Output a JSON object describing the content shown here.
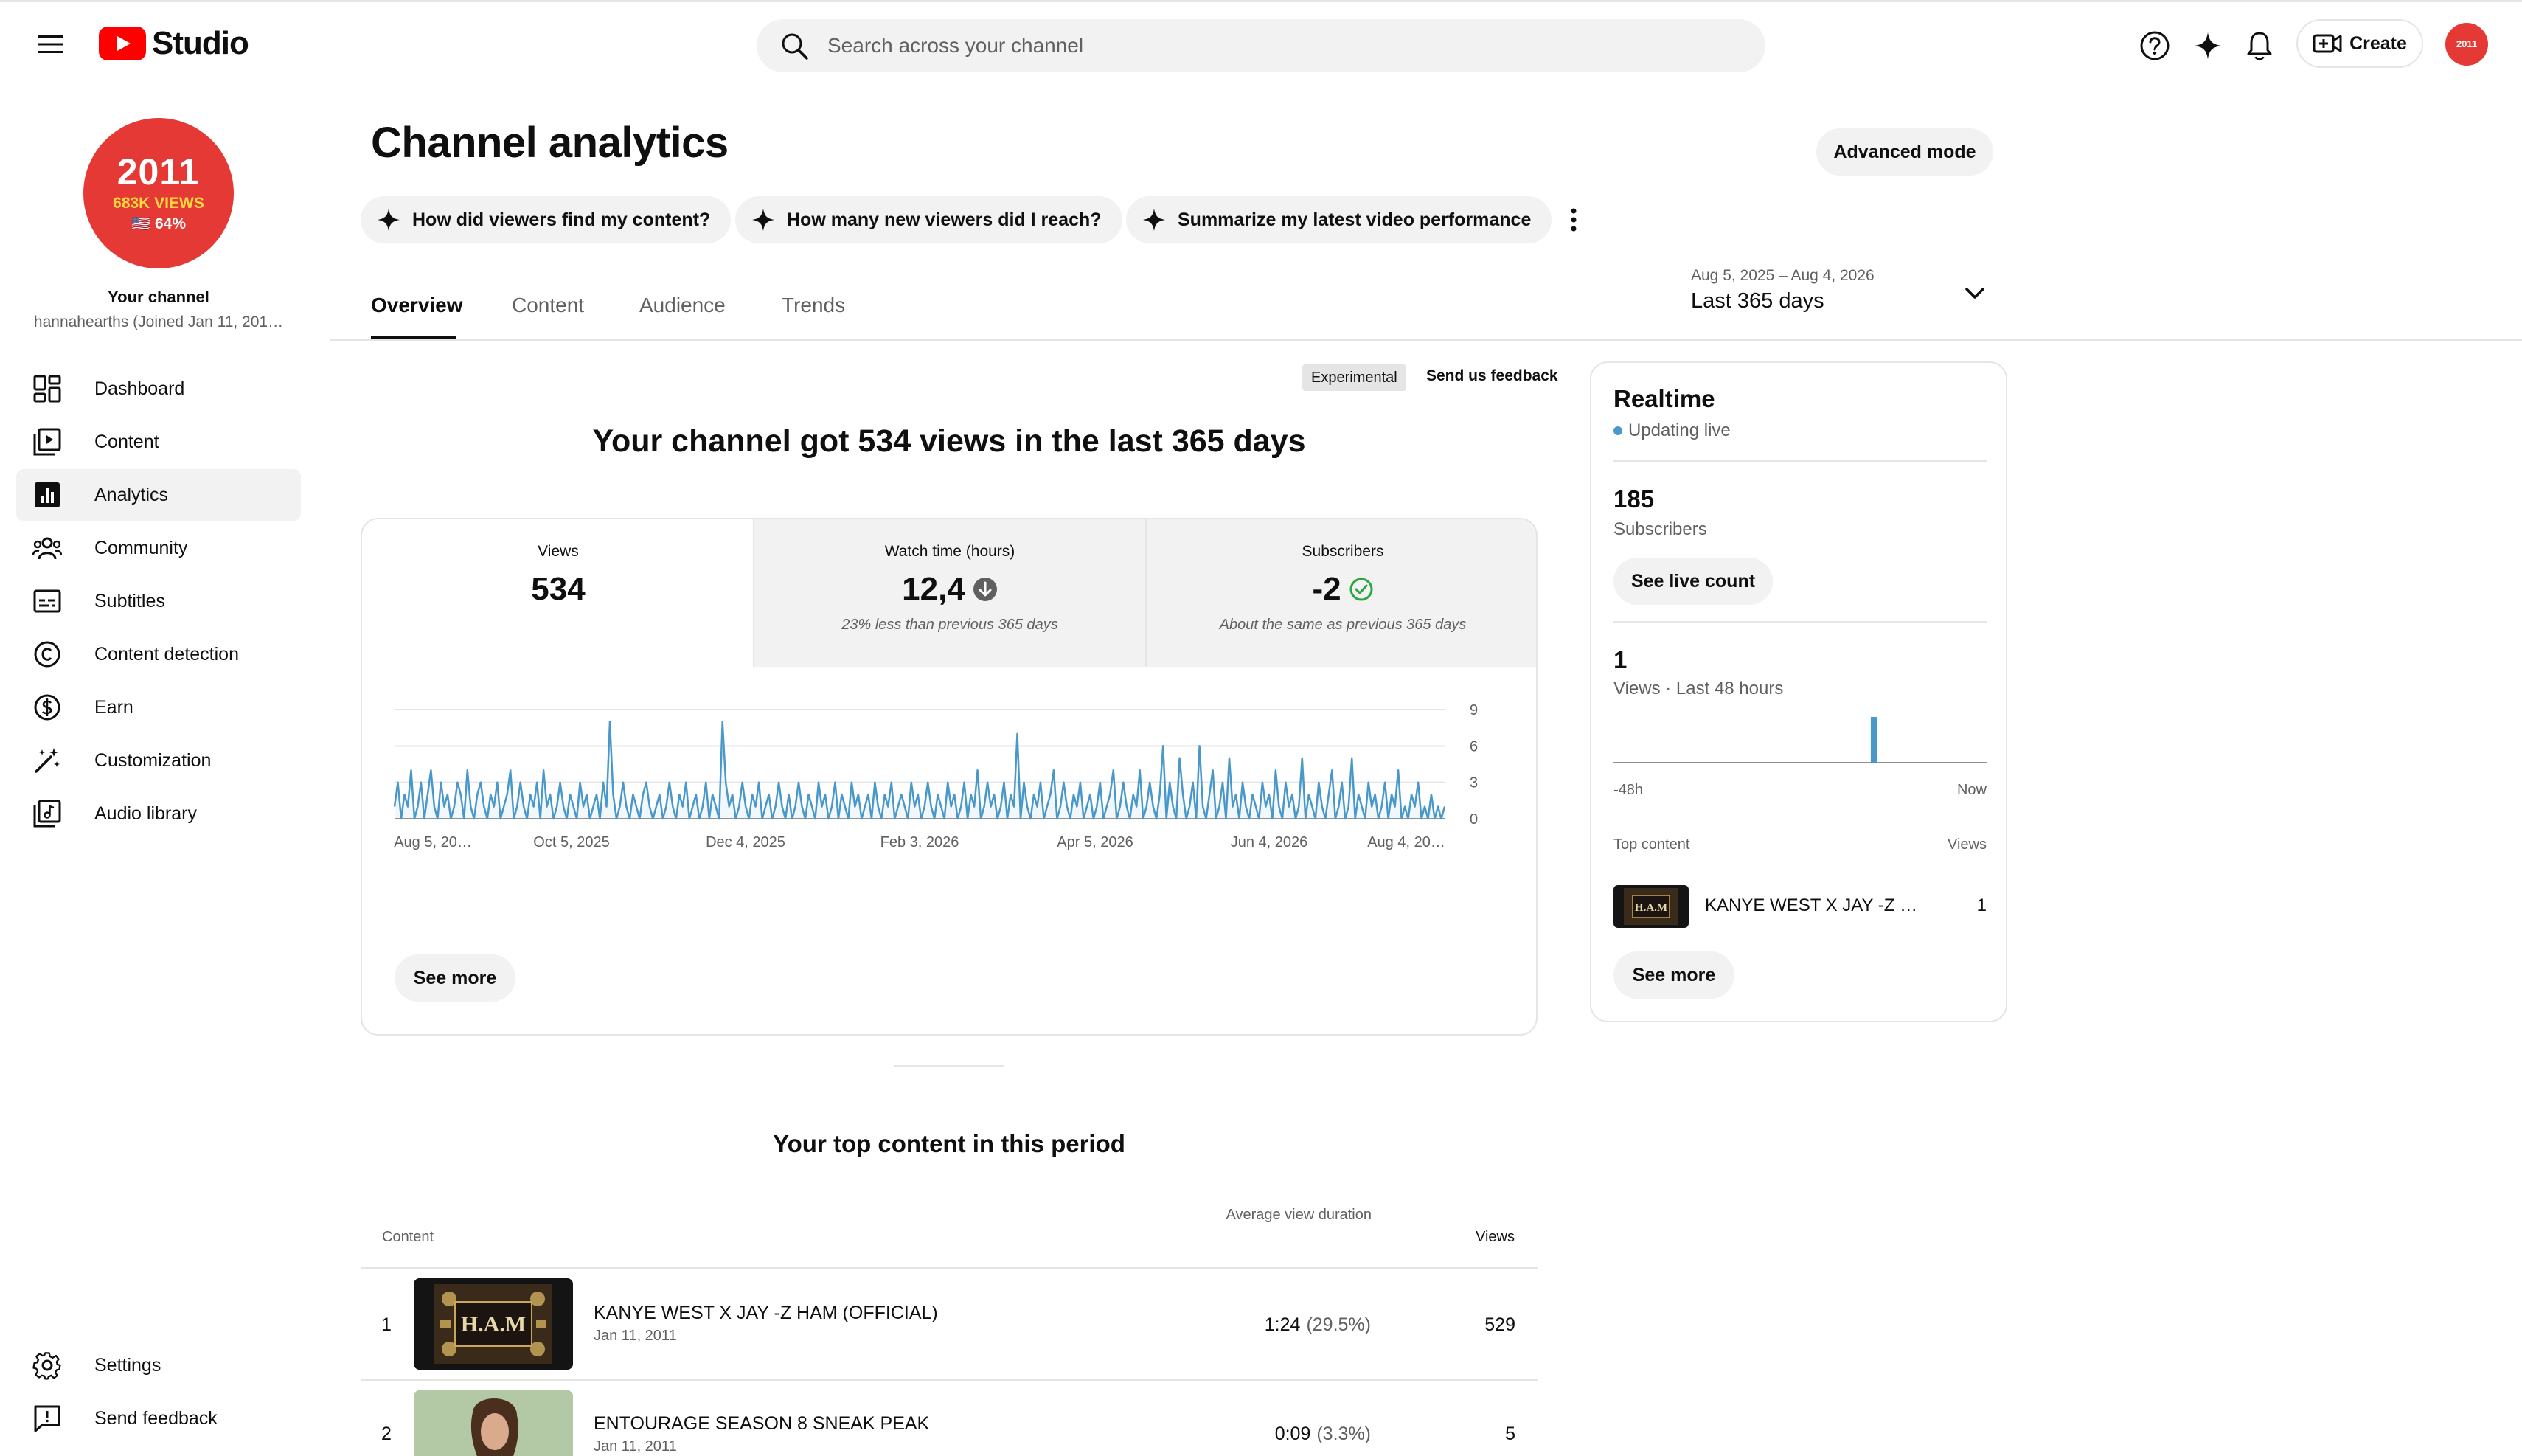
{
  "app": {
    "name": "Studio"
  },
  "search": {
    "placeholder": "Search across your channel"
  },
  "header": {
    "create_label": "Create",
    "avatar_text": "2011"
  },
  "channel": {
    "avatar_line1": "2011",
    "avatar_line2": "683K VIEWS",
    "avatar_line3": "🇺🇸 64%",
    "label": "Your channel",
    "handle": "hannahearths (Joined Jan 11, 201…"
  },
  "sidebar": {
    "items": [
      {
        "label": "Dashboard",
        "icon": "dashboard-icon"
      },
      {
        "label": "Content",
        "icon": "content-icon"
      },
      {
        "label": "Analytics",
        "icon": "analytics-icon",
        "active": true
      },
      {
        "label": "Community",
        "icon": "community-icon"
      },
      {
        "label": "Subtitles",
        "icon": "subtitles-icon"
      },
      {
        "label": "Content detection",
        "icon": "copyright-icon"
      },
      {
        "label": "Earn",
        "icon": "dollar-icon"
      },
      {
        "label": "Customization",
        "icon": "magic-wand-icon"
      },
      {
        "label": "Audio library",
        "icon": "audio-library-icon"
      }
    ],
    "bottom": [
      {
        "label": "Settings",
        "icon": "gear-icon"
      },
      {
        "label": "Send feedback",
        "icon": "feedback-icon"
      }
    ]
  },
  "page": {
    "title": "Channel analytics",
    "advanced_mode": "Advanced mode",
    "chips": [
      "How did viewers find my content?",
      "How many new viewers did I reach?",
      "Summarize my latest video performance"
    ],
    "tabs": [
      "Overview",
      "Content",
      "Audience",
      "Trends"
    ],
    "date_range": {
      "sub": "Aug 5, 2025 – Aug 4, 2026",
      "main": "Last 365 days"
    }
  },
  "overview": {
    "experimental": "Experimental",
    "feedback": "Send us feedback",
    "headline": "Your channel got 534 views in the last 365 days",
    "stats": [
      {
        "label": "Views",
        "value": "534",
        "note": ""
      },
      {
        "label": "Watch time (hours)",
        "value": "12,4",
        "note": "23% less than previous 365 days"
      },
      {
        "label": "Subscribers",
        "value": "-2",
        "note": "About the same as previous 365 days"
      }
    ],
    "see_more": "See more"
  },
  "chart_data": {
    "type": "line",
    "x_tick_labels": [
      "Aug 5, 20…",
      "Oct 5, 2025",
      "Dec 4, 2025",
      "Feb 3, 2026",
      "Apr 5, 2026",
      "Jun 4, 2026",
      "Aug 4, 20…"
    ],
    "y_ticks": [
      0,
      3,
      6,
      9
    ],
    "ylim": [
      0,
      9
    ],
    "grid": true,
    "values": [
      1,
      3,
      0,
      2,
      1,
      4,
      0,
      1,
      3,
      0,
      2,
      4,
      1,
      0,
      3,
      1,
      2,
      0,
      1,
      3,
      2,
      0,
      4,
      1,
      0,
      2,
      3,
      1,
      0,
      2,
      1,
      3,
      0,
      1,
      2,
      4,
      0,
      1,
      3,
      1,
      0,
      2,
      1,
      3,
      0,
      4,
      1,
      2,
      0,
      1,
      3,
      1,
      0,
      2,
      1,
      0,
      3,
      1,
      2,
      0,
      1,
      2,
      0,
      3,
      1,
      8,
      2,
      0,
      1,
      3,
      1,
      0,
      2,
      1,
      0,
      2,
      3,
      1,
      0,
      1,
      2,
      0,
      1,
      3,
      1,
      0,
      2,
      1,
      3,
      0,
      1,
      2,
      0,
      1,
      3,
      0,
      2,
      1,
      0,
      8,
      3,
      1,
      2,
      0,
      1,
      3,
      1,
      0,
      2,
      1,
      3,
      0,
      1,
      2,
      0,
      1,
      3,
      1,
      0,
      2,
      0,
      1,
      3,
      1,
      0,
      2,
      1,
      0,
      3,
      1,
      2,
      0,
      1,
      3,
      0,
      2,
      1,
      0,
      3,
      1,
      2,
      0,
      1,
      2,
      0,
      3,
      1,
      0,
      2,
      1,
      3,
      0,
      1,
      2,
      1,
      0,
      3,
      1,
      2,
      0,
      1,
      3,
      1,
      0,
      2,
      1,
      0,
      3,
      1,
      2,
      0,
      1,
      3,
      0,
      2,
      1,
      4,
      0,
      1,
      3,
      1,
      2,
      0,
      1,
      3,
      0,
      2,
      1,
      7,
      0,
      3,
      1,
      0,
      2,
      1,
      3,
      0,
      1,
      2,
      4,
      0,
      1,
      3,
      1,
      0,
      2,
      1,
      3,
      0,
      1,
      2,
      0,
      1,
      3,
      0,
      1,
      2,
      4,
      0,
      1,
      3,
      1,
      0,
      2,
      1,
      4,
      0,
      1,
      3,
      1,
      0,
      2,
      6,
      0,
      3,
      1,
      0,
      5,
      2,
      0,
      1,
      3,
      0,
      6,
      1,
      0,
      2,
      4,
      0,
      1,
      3,
      0,
      5,
      1,
      2,
      0,
      3,
      1,
      0,
      2,
      1,
      0,
      3,
      1,
      2,
      0,
      4,
      1,
      0,
      3,
      1,
      2,
      0,
      1,
      5,
      0,
      2,
      1,
      0,
      3,
      1,
      0,
      2,
      4,
      0,
      1,
      3,
      0,
      1,
      5,
      0,
      2,
      1,
      0,
      3,
      1,
      2,
      0,
      1,
      3,
      0,
      2,
      1,
      4,
      0,
      1,
      0,
      2,
      1,
      3,
      0,
      1,
      0,
      2,
      0,
      1,
      0,
      1
    ]
  },
  "top_content": {
    "title": "Your top content in this period",
    "col_content": "Content",
    "col_avg": "Average view duration",
    "col_views": "Views",
    "rows": [
      {
        "rank": "1",
        "title": "KANYE WEST X JAY -Z HAM (OFFICIAL)",
        "date": "Jan 11, 2011",
        "avg": "1:24",
        "pct": "(29.5%)",
        "views": "529"
      },
      {
        "rank": "2",
        "title": "ENTOURAGE SEASON 8 SNEAK PEAK",
        "date": "Jan 11, 2011",
        "avg": "0:09",
        "pct": "(3.3%)",
        "views": "5"
      }
    ],
    "thumb1_text": "H.A.M"
  },
  "realtime": {
    "title": "Realtime",
    "live": "Updating live",
    "subs": "185",
    "subs_label": "Subscribers",
    "live_count": "See live count",
    "views": "1",
    "views_label": "Views · Last 48 hours",
    "left_label": "-48h",
    "right_label": "Now",
    "top_content": "Top content",
    "top_views": "Views",
    "item_title": "KANYE WEST X JAY -Z HA…",
    "item_views": "1",
    "see_more": "See more",
    "chart": {
      "type": "bar",
      "hours": 48,
      "bar_hour": 33,
      "value": 1,
      "ylim": [
        0,
        1
      ]
    }
  },
  "colors": {
    "accent": "#4a98c9",
    "brand": "#ff0000",
    "avatar": "#e53935"
  }
}
